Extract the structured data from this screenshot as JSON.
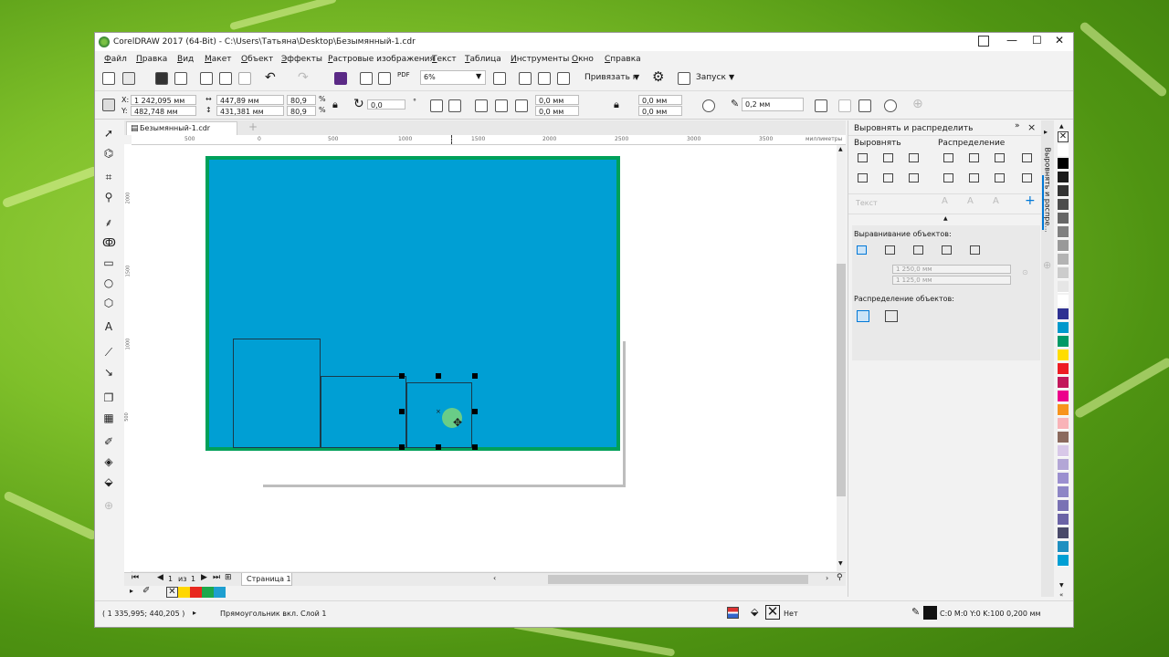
{
  "window": {
    "title": "CorelDRAW 2017 (64-Bit) - C:\\Users\\Татьяна\\Desktop\\Безымянный-1.cdr",
    "controls": {
      "minimize": "—",
      "maximize": "☐",
      "close": "✕"
    }
  },
  "menu": [
    "Файл",
    "Правка",
    "Вид",
    "Макет",
    "Объект",
    "Эффекты",
    "Растровые изображения",
    "Текст",
    "Таблица",
    "Инструменты",
    "Окно",
    "Справка"
  ],
  "toolbar": {
    "zoom": "6%",
    "snap_label": "Привязать к",
    "launch_label": "Запуск",
    "pdf_label": "PDF"
  },
  "propbar": {
    "x_label": "X:",
    "x": "1 242,095 мм",
    "y_label": "Y:",
    "y": "482,748 мм",
    "w": "447,89 мм",
    "h": "431,381 мм",
    "sx": "80,9",
    "sy": "80,9",
    "pct": "%",
    "rotation": "0,0",
    "corner_tl": "0,0 мм",
    "corner_bl": "0,0 мм",
    "corner_tr": "0,0 мм",
    "corner_br": "0,0 мм",
    "outline": "0,2 мм"
  },
  "document_tab": "Безымянный-1.cdr",
  "ruler_h": [
    "500",
    "0",
    "500",
    "1000",
    "1500",
    "2000",
    "2500",
    "3000",
    "3500",
    "миллиметры"
  ],
  "ruler_v": [
    "2000",
    "1500",
    "1000",
    "500"
  ],
  "page_nav": {
    "current": "1",
    "of": "из",
    "total": "1",
    "page_tab": "Страница 1"
  },
  "docker": {
    "title": "Выровнять и распределить",
    "align_heading": "Выровнять",
    "distribute_heading": "Распределение",
    "text_label": "Текст",
    "align_objects_heading": "Выравнивание объектов:",
    "coord_x": "1 250,0 мм",
    "coord_y": "1 125,0 мм",
    "distribute_objects_heading": "Распределение объектов:",
    "side_tab": "Выровнять и распре..."
  },
  "palette_colors": [
    "#ffffff",
    "#000000",
    "#1a1a1a",
    "#333333",
    "#4d4d4d",
    "#666666",
    "#808080",
    "#999999",
    "#b3b3b3",
    "#cccccc",
    "#e6e6e6",
    "#ffffff",
    "#2e3192",
    "#0099cc",
    "#009966",
    "#ffdd00",
    "#ed1c24",
    "#c2185b",
    "#ec008c",
    "#f7941d",
    "#f9b3b8",
    "#8b6a5e",
    "#d8c8e8",
    "#b3a6d6",
    "#9b8fcf",
    "#8e86c6",
    "#7a72b4",
    "#6b63a6",
    "#4a4a6a",
    "#1f8fc0",
    "#009fd4"
  ],
  "doc_palette": [
    "#ffd700",
    "#e8281e",
    "#1ea84b",
    "#1e9fd0"
  ],
  "status": {
    "coords": "( 1 335,995; 440,205 )",
    "object_info": "Прямоугольник вкл. Слой 1",
    "fill_none": "Нет",
    "outline_color": "C:0 M:0 Y:0 K:100",
    "outline_width": "0,200 мм"
  },
  "colors": {
    "page_fill": "#009fd4",
    "page_border": "#00a05a",
    "accent": "#0078d7"
  }
}
